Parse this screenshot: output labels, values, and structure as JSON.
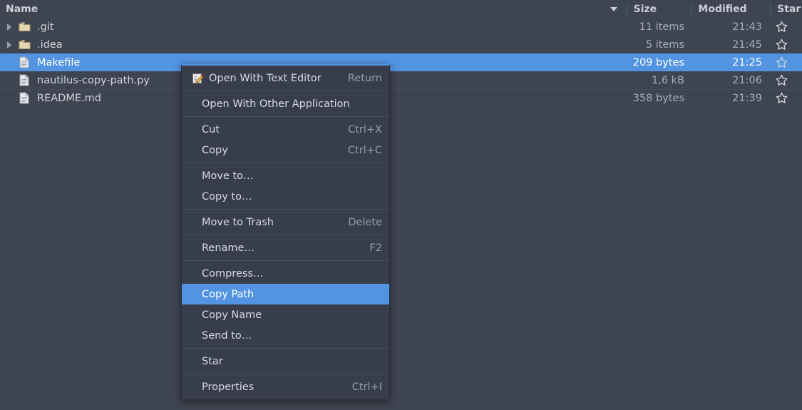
{
  "file_manager": {
    "columns": {
      "name": "Name",
      "size": "Size",
      "modified": "Modified",
      "star": "Star",
      "sort_indicator": "sort-descending-caret"
    },
    "rows": [
      {
        "name": ".git",
        "kind": "folder",
        "expandable": true,
        "size": "11 items",
        "modified": "21:43",
        "starred": false,
        "selected": false
      },
      {
        "name": ".idea",
        "kind": "folder",
        "expandable": true,
        "size": "5 items",
        "modified": "21:45",
        "starred": false,
        "selected": false
      },
      {
        "name": "Makefile",
        "kind": "file",
        "expandable": false,
        "size": "209 bytes",
        "modified": "21:25",
        "starred": false,
        "selected": true
      },
      {
        "name": "nautilus-copy-path.py",
        "kind": "file",
        "expandable": false,
        "size": "1,6 kB",
        "modified": "21:06",
        "starred": false,
        "selected": false
      },
      {
        "name": "README.md",
        "kind": "file",
        "expandable": false,
        "size": "358 bytes",
        "modified": "21:39",
        "starred": false,
        "selected": false
      }
    ]
  },
  "context_menu": {
    "items": [
      {
        "type": "item",
        "label": "Open With Text Editor",
        "accel": "Return",
        "icon": "text-editor-icon",
        "highlighted": false
      },
      {
        "type": "separator"
      },
      {
        "type": "item",
        "label": "Open With Other Application",
        "accel": "",
        "icon": null,
        "highlighted": false
      },
      {
        "type": "separator"
      },
      {
        "type": "item",
        "label": "Cut",
        "accel": "Ctrl+X",
        "icon": null,
        "highlighted": false
      },
      {
        "type": "item",
        "label": "Copy",
        "accel": "Ctrl+C",
        "icon": null,
        "highlighted": false
      },
      {
        "type": "separator"
      },
      {
        "type": "item",
        "label": "Move to…",
        "accel": "",
        "icon": null,
        "highlighted": false
      },
      {
        "type": "item",
        "label": "Copy to…",
        "accel": "",
        "icon": null,
        "highlighted": false
      },
      {
        "type": "separator"
      },
      {
        "type": "item",
        "label": "Move to Trash",
        "accel": "Delete",
        "icon": null,
        "highlighted": false
      },
      {
        "type": "separator"
      },
      {
        "type": "item",
        "label": "Rename…",
        "accel": "F2",
        "icon": null,
        "highlighted": false
      },
      {
        "type": "separator"
      },
      {
        "type": "item",
        "label": "Compress…",
        "accel": "",
        "icon": null,
        "highlighted": false
      },
      {
        "type": "item",
        "label": "Copy Path",
        "accel": "",
        "icon": null,
        "highlighted": true
      },
      {
        "type": "item",
        "label": "Copy Name",
        "accel": "",
        "icon": null,
        "highlighted": false
      },
      {
        "type": "item",
        "label": "Send to…",
        "accel": "",
        "icon": null,
        "highlighted": false
      },
      {
        "type": "separator"
      },
      {
        "type": "item",
        "label": "Star",
        "accel": "",
        "icon": null,
        "highlighted": false
      },
      {
        "type": "separator"
      },
      {
        "type": "item",
        "label": "Properties",
        "accel": "Ctrl+I",
        "icon": null,
        "highlighted": false
      }
    ]
  },
  "colors": {
    "background": "#3e4450",
    "selection": "#5294e2",
    "menu_background": "#373d4a",
    "folder_icon": "#e8d9b4",
    "muted_text": "#a7adb8"
  }
}
